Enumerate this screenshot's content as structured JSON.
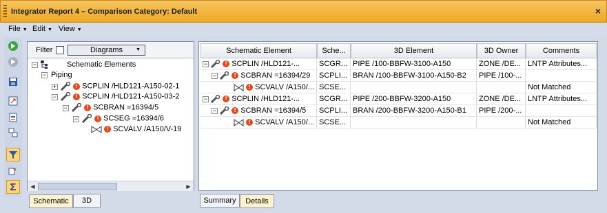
{
  "window": {
    "title": "Integrator Report 4 – Comparison Category: Default",
    "close": "×"
  },
  "menus": [
    {
      "label": "File"
    },
    {
      "label": "Edit"
    },
    {
      "label": "View"
    }
  ],
  "filter": {
    "label": "Filter",
    "dropdown_value": "Diagrams"
  },
  "tree": {
    "root": "Schematic Elements",
    "piping": "Piping",
    "items": [
      {
        "label": "SCPLIN /HLD121-A150-02-1"
      },
      {
        "label": "SCPLIN /HLD121-A150-03-2"
      },
      {
        "label": "SCBRAN =16394/5"
      },
      {
        "label": "SCSEG =16394/6"
      },
      {
        "label": "SCVALV /A150/V-19"
      }
    ]
  },
  "left_tabs": [
    {
      "label": "Schematic"
    },
    {
      "label": "3D"
    }
  ],
  "table": {
    "headers": [
      "Schematic Element",
      "Sche...",
      "3D Element",
      "3D Owner",
      "Comments"
    ],
    "rows": [
      {
        "schematic": "SCPLIN /HLD121-...",
        "sche": "SCGR...",
        "el3d": "PIPE /100-BBFW-3100-A150",
        "owner": "ZONE /DE...",
        "comments": "LNTP Attributes..."
      },
      {
        "schematic": "SCBRAN =16394/29",
        "sche": "SCPLI...",
        "el3d": "BRAN /100-BBFW-3100-A150-B2",
        "owner": "PIPE /100-...",
        "comments": ""
      },
      {
        "schematic": "SCVALV /A150/...",
        "sche": "SCSE...",
        "el3d": "",
        "owner": "",
        "comments": "Not Matched"
      },
      {
        "schematic": "SCPLIN /HLD121-...",
        "sche": "SCGR...",
        "el3d": "PIPE /200-BBFW-3200-A150",
        "owner": "ZONE /DE...",
        "comments": "LNTP Attributes..."
      },
      {
        "schematic": "SCBRAN =16394/5",
        "sche": "SCPLI...",
        "el3d": "BRAN /200-BBFW-3200-A150-B1",
        "owner": "PIPE /200-...",
        "comments": ""
      },
      {
        "schematic": "SCVALV /A150/...",
        "sche": "SCSE...",
        "el3d": "",
        "owner": "",
        "comments": "Not Matched"
      }
    ]
  },
  "right_tabs": [
    {
      "label": "Summary"
    },
    {
      "label": "Details"
    }
  ],
  "colors": {
    "title_bar": "#eea824",
    "warning_dot": "#e24a1b",
    "selected_tab": "#fff3cf"
  },
  "icons": [
    "close-icon",
    "green-forward-icon",
    "gray-forward-icon",
    "save-icon",
    "export-icon",
    "report-icon",
    "compare-icon",
    "filter-icon",
    "attributes-icon",
    "sum-icon",
    "pipe-icon",
    "valve-icon",
    "warning-icon",
    "tree-root-icon"
  ]
}
